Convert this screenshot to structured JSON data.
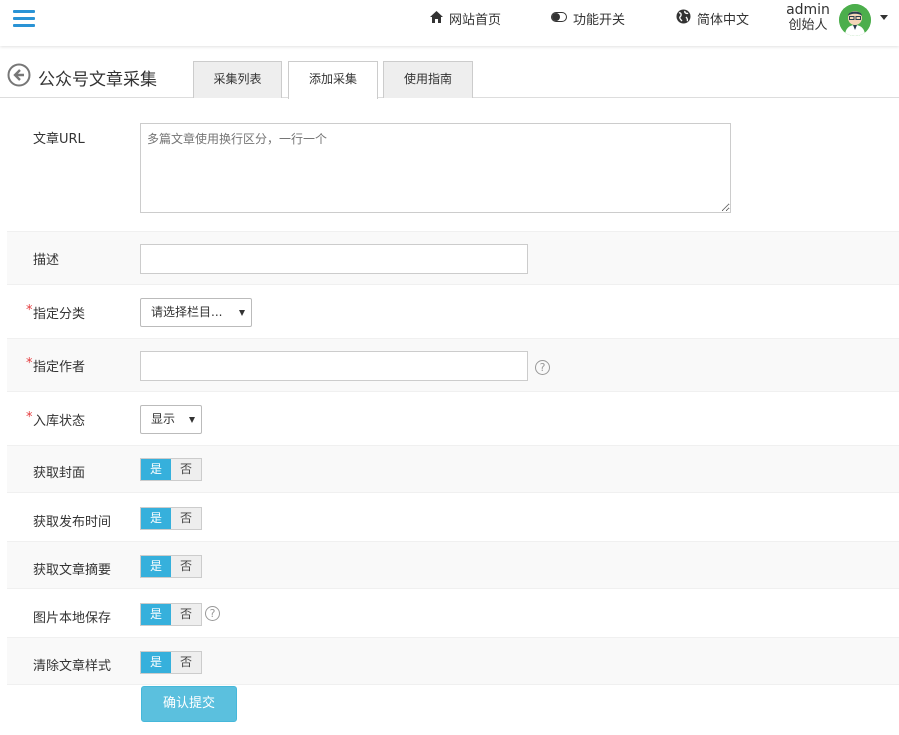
{
  "topbar": {
    "nav": [
      {
        "label": "网站首页",
        "icon": "home-icon"
      },
      {
        "label": "功能开关",
        "icon": "toggle-icon"
      },
      {
        "label": "简体中文",
        "icon": "globe-icon"
      }
    ],
    "user": {
      "name": "admin",
      "role": "创始人"
    }
  },
  "page": {
    "title": "公众号文章采集",
    "tabs": [
      {
        "label": "采集列表",
        "active": false
      },
      {
        "label": "添加采集",
        "active": true
      },
      {
        "label": "使用指南",
        "active": false
      }
    ]
  },
  "form": {
    "url_label": "文章URL",
    "url_placeholder": "多篇文章使用换行区分，一行一个",
    "desc_label": "描述",
    "desc_value": "",
    "category_label": "指定分类",
    "category_value": "请选择栏目...",
    "author_label": "指定作者",
    "author_value": "",
    "status_label": "入库状态",
    "status_value": "显示",
    "cover_label": "获取封面",
    "pubtime_label": "获取发布时间",
    "summary_label": "获取文章摘要",
    "localsave_label": "图片本地保存",
    "clearstyle_label": "清除文章样式",
    "yes_label": "是",
    "no_label": "否",
    "required_mark": "*",
    "help_mark": "?",
    "submit_label": "确认提交"
  },
  "colors": {
    "accent": "#2a93d5",
    "toggle_on": "#36b0dc",
    "submit": "#5bc0de",
    "required": "#e4393c"
  }
}
